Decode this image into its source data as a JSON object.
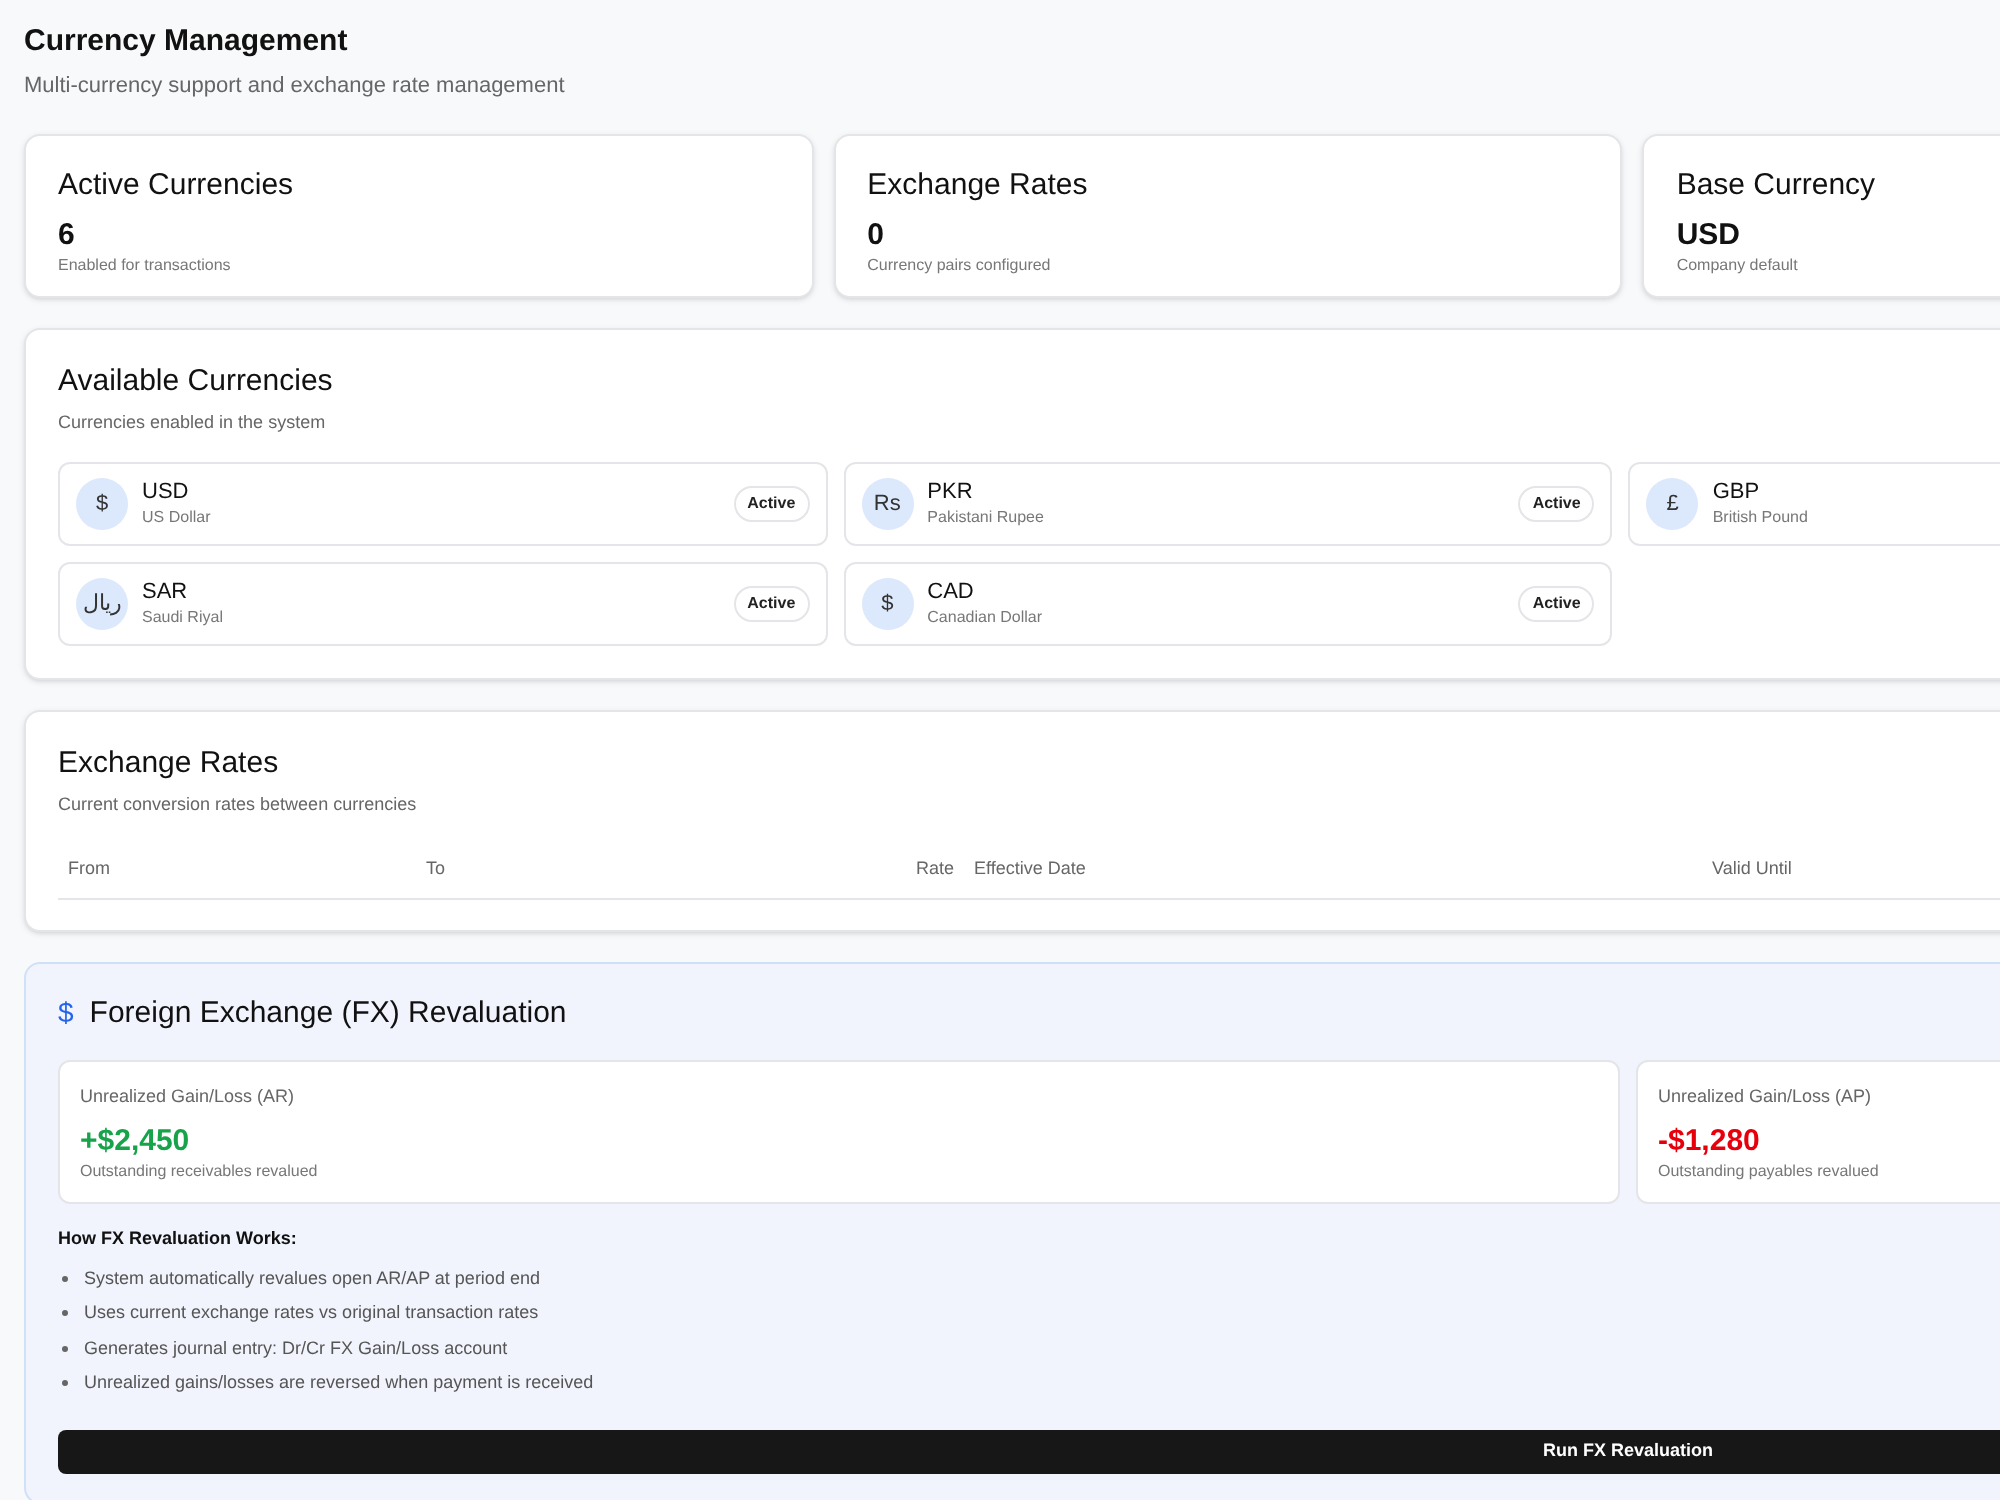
{
  "header": {
    "title": "Currency Management",
    "subtitle": "Multi-currency support and exchange rate management"
  },
  "stats": [
    {
      "title": "Active Currencies",
      "value": "6",
      "note": "Enabled for transactions"
    },
    {
      "title": "Exchange Rates",
      "value": "0",
      "note": "Currency pairs configured"
    },
    {
      "title": "Base Currency",
      "value": "USD",
      "note": "Company default"
    }
  ],
  "available": {
    "title": "Available Currencies",
    "subtitle": "Currencies enabled in the system",
    "currencies": [
      {
        "symbol": "$",
        "code": "USD",
        "name": "US Dollar",
        "status": "Active"
      },
      {
        "symbol": "Rs",
        "code": "PKR",
        "name": "Pakistani Rupee",
        "status": "Active"
      },
      {
        "symbol": "£",
        "code": "GBP",
        "name": "British Pound"
      },
      {
        "symbol": "ريال",
        "code": "SAR",
        "name": "Saudi Riyal",
        "status": "Active"
      },
      {
        "symbol": "$",
        "code": "CAD",
        "name": "Canadian Dollar",
        "status": "Active"
      }
    ]
  },
  "rates": {
    "title": "Exchange Rates",
    "subtitle": "Current conversion rates between currencies",
    "columns": [
      "From",
      "To",
      "Rate",
      "Effective Date",
      "Valid Until"
    ]
  },
  "fx": {
    "icon": "$",
    "title": "Foreign Exchange (FX) Revaluation",
    "cards": [
      {
        "label": "Unrealized Gain/Loss (AR)",
        "value": "+$2,450",
        "note": "Outstanding receivables revalued",
        "kind": "gain"
      },
      {
        "label": "Unrealized Gain/Loss (AP)",
        "value": "-$1,280",
        "note": "Outstanding payables revalued",
        "kind": "loss"
      }
    ],
    "how_title": "How FX Revaluation Works:",
    "steps": [
      "System automatically revalues open AR/AP at period end",
      "Uses current exchange rates vs original transaction rates",
      "Generates journal entry: Dr/Cr FX Gain/Loss account",
      "Unrealized gains/losses are reversed when payment is received"
    ],
    "button": "Run FX Revaluation"
  }
}
